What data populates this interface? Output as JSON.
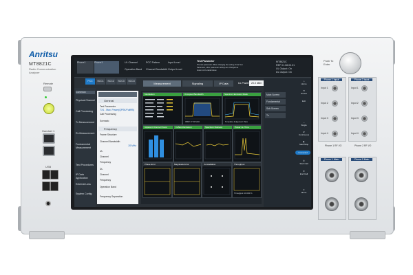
{
  "device": {
    "brand": "Anritsu",
    "model": "MT8821C",
    "subtitle": "Radio Communication Analyzer",
    "remote_label": "Remote",
    "local_label": "Local",
    "handset_label": "Handset 1",
    "usb_label": "USB",
    "push_enter_label": "Push To Enter"
  },
  "rf_panels": {
    "top_left_title": "Phone 1 Input",
    "top_right_title": "Phone 2 Input",
    "mid_left_title": "Phone 1 RF I/O",
    "mid_right_title": "Phone 2 RF I/O",
    "main_left_title": "Phone 1 Main",
    "main_right_title": "Phone 2 Main",
    "port_labels": [
      "Input 1",
      "Input 2",
      "Input 3",
      "Input 4"
    ]
  },
  "screen": {
    "phones": [
      {
        "label": "Phone1",
        "sub": "LTE"
      },
      {
        "label": "Phone1",
        "sub": "LTE"
      }
    ],
    "status": {
      "ul_channel_label": "UL Channel",
      "ue_pattern_label": "PCC Pattern",
      "input_level_label": "Input Level",
      "op_band_label": "Operation Band",
      "ch_bw_label": "Channel Bandwidth",
      "output_level_label": "Output Level"
    },
    "test_param_title": "Test Parameter",
    "test_param_text": "The test parameter. When changing the setting of the Test Parameter, other parameter settings are changed as shown in the table below.",
    "right_info": [
      "MT8821C",
      "REF 01.08.00.01",
      "UL Output: On",
      "DL Output: On"
    ],
    "cell_tabs": [
      "PCC",
      "SCC1",
      "SCC2",
      "SCC3",
      "SCC4"
    ],
    "main_tabs": [
      "Measurement",
      "Signaling",
      "IP Data"
    ],
    "ul_power_label": "UL Power",
    "ul_power_value": "20.0 dBm",
    "left_menu": [
      "Common",
      "Physical Channel",
      "Call Processing",
      "Tx Measurement",
      "Rx Measurement",
      "Fundamental Measurement",
      "Test Procedures",
      "IP Data Application",
      "External Loss",
      "System Config"
    ],
    "param_sections": [
      {
        "title": "General",
        "rows": [
          {
            "label": "Test Parameter",
            "value": ""
          },
          {
            "label": "TX1 - Max. Power(QPSK/FullRB)",
            "value": ""
          },
          {
            "label": "Call Processing",
            "value": ""
          },
          {
            "label": "Scenario",
            "value": ""
          }
        ]
      },
      {
        "title": "Frequency",
        "rows": [
          {
            "label": "Frame Structure",
            "value": ""
          },
          {
            "label": "Channel Bandwidth",
            "value": "20 MHz"
          },
          {
            "label": "UL",
            "value": ""
          },
          {
            "label": "Channel",
            "value": ""
          },
          {
            "label": "Frequency",
            "value": ""
          },
          {
            "label": "DL",
            "value": ""
          },
          {
            "label": "Channel",
            "value": ""
          },
          {
            "label": "Frequency",
            "value": ""
          },
          {
            "label": "Operation Band",
            "value": ""
          }
        ]
      },
      {
        "title": "",
        "rows": [
          {
            "label": "Frequency Separation",
            "value": ""
          }
        ]
      }
    ],
    "meas_heads": [
      "Modulation",
      "Occupied Bandwidth",
      "Spectrum Emission Mask",
      "Adjacent Channel Power",
      "In-Band Emission",
      "Spectrum Flatness",
      "Power vs. Time",
      "Phase Error",
      "Magnitude Error",
      "Constellation",
      "Throughput"
    ],
    "meas_values": [
      "OBW  17.63 MHz",
      "Template Judgement  Pass",
      "Throughput   100.000 %"
    ],
    "side_menu": [
      "Main Screen",
      "Fundamental",
      "Sub Screen",
      "Tx"
    ],
    "right_buttons": [
      "Home",
      "Preset",
      "Exit",
      "Single",
      "Continuous",
      "Start/Stop",
      "Connected",
      "Start Call",
      "End Call",
      "Menu"
    ],
    "accent_colors": {
      "pass": "#3aa040",
      "tab": "#1f7ac8",
      "trace": "#f2d13a",
      "dot": "#ffffff"
    }
  }
}
